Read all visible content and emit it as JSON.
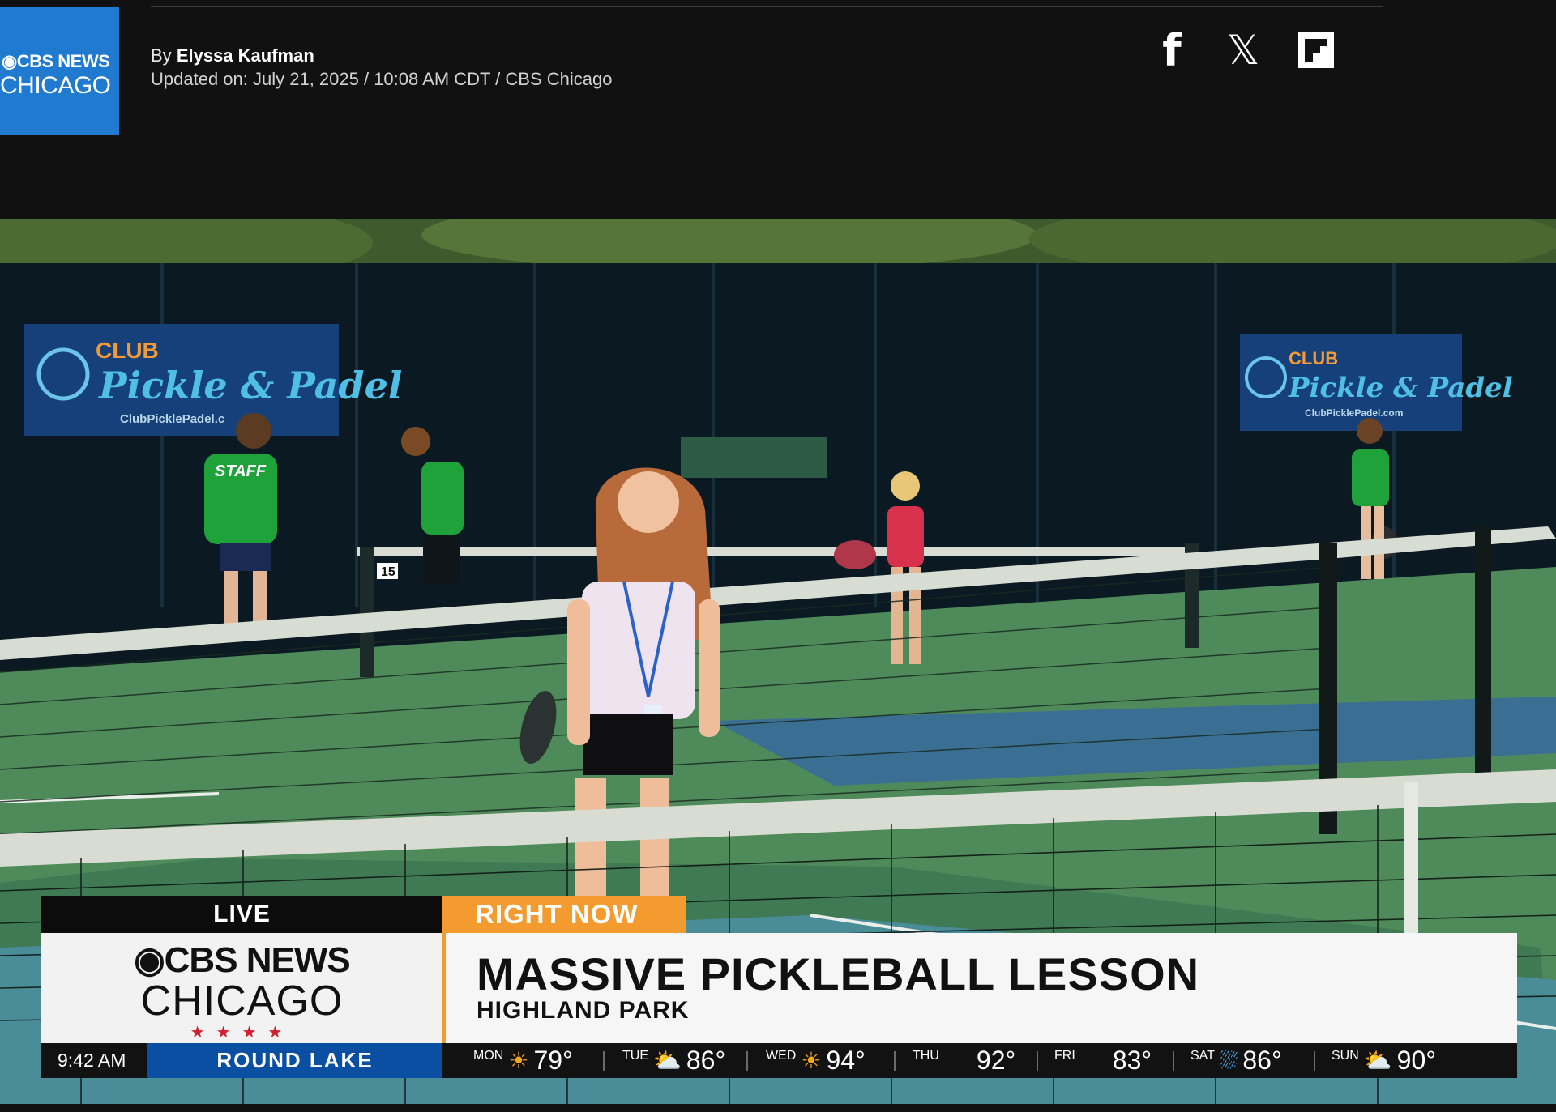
{
  "article": {
    "byline_prefix": "By",
    "author": "Elyssa Kaufman",
    "updated": "Updated on: July 21, 2025 / 10:08 AM CDT / CBS Chicago"
  },
  "logo": {
    "line1": "CBS NEWS",
    "line2": "CHICAGO"
  },
  "share": [
    {
      "name": "facebook",
      "glyph": "f"
    },
    {
      "name": "x",
      "glyph": "𝕏"
    },
    {
      "name": "flipboard",
      "glyph": ""
    }
  ],
  "video": {
    "banners": [
      {
        "line1": "CLUB",
        "line2": "Pickle & Padel",
        "url": "ClubPicklePadel.c"
      },
      {
        "line1": "CLUB",
        "line2": "Pickle & Padel",
        "url": "ClubPicklePadel.com"
      }
    ],
    "court_number": "15",
    "shirt_text": "STAFF"
  },
  "lower_third": {
    "live": "LIVE",
    "right_now": "RIGHT NOW",
    "brand_line1": "CBS NEWS",
    "brand_line2": "CHICAGO",
    "stars": "★★★★",
    "headline": "MASSIVE PICKLEBALL LESSON",
    "subhead": "HIGHLAND PARK",
    "time": "9:42 AM",
    "location": "ROUND LAKE",
    "forecast": [
      {
        "day": "MON",
        "icon": "☀",
        "temp": "79°",
        "color": "#f6a623"
      },
      {
        "day": "TUE",
        "icon": "⛅",
        "temp": "86°",
        "color": "#ffffff"
      },
      {
        "day": "WED",
        "icon": "☀",
        "temp": "94°",
        "color": "#f6a623"
      },
      {
        "day": "THU",
        "icon": "",
        "temp": "92°",
        "color": "#ffffff"
      },
      {
        "day": "FRI",
        "icon": "",
        "temp": "83°",
        "color": "#ffffff"
      },
      {
        "day": "SAT",
        "icon": "⛆",
        "temp": "86°",
        "color": "#4fb6ff"
      },
      {
        "day": "SUN",
        "icon": "⛅",
        "temp": "90°",
        "color": "#f6a623"
      }
    ]
  }
}
